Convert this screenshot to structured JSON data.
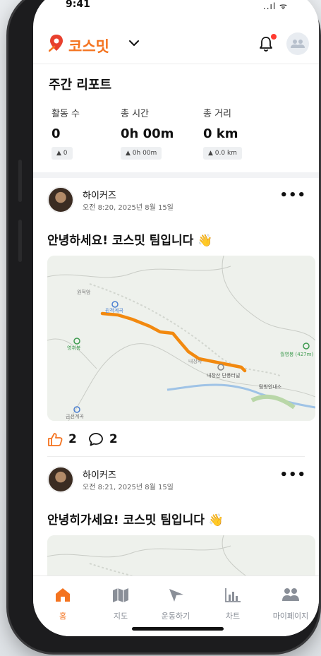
{
  "status_bar": {
    "time": "9:41",
    "signal": "..ıl ᯤ"
  },
  "app": {
    "brand": "코스밋",
    "accent_color": "#f4731f",
    "notification_dot_color": "#ff3b30"
  },
  "weekly_report": {
    "title": "주간 리포트",
    "stats": [
      {
        "label": "활동 수",
        "value": "0",
        "delta": "▲ 0"
      },
      {
        "label": "총 시간",
        "value": "0h 00m",
        "delta": "▲ 0h 00m"
      },
      {
        "label": "총 거리",
        "value": "0 km",
        "delta": "▲ 0.0 km"
      }
    ]
  },
  "posts": [
    {
      "user": "하이커즈",
      "time": "오전 8:20, 2025년 8월 15일",
      "text": "안녕하세요! 코스밋 팀입니다 👋",
      "likes": "2",
      "comments": "2",
      "map_labels": [
        "원적암",
        "원적계곡",
        "영취봉",
        "내장사",
        "내장산 단풍터널",
        "탐방안내소",
        "월영봉 (427m)",
        "금선계곡"
      ]
    },
    {
      "user": "하이커즈",
      "time": "오전 8:21, 2025년 8월 15일",
      "text": "안녕히가세요! 코스밋 팀입니다 👋"
    }
  ],
  "tabs": [
    {
      "label": "홈",
      "icon": "home-icon",
      "active": true
    },
    {
      "label": "지도",
      "icon": "map-icon",
      "active": false
    },
    {
      "label": "운동하기",
      "icon": "navigation-icon",
      "active": false
    },
    {
      "label": "차트",
      "icon": "chart-icon",
      "active": false
    },
    {
      "label": "마이페이지",
      "icon": "people-icon",
      "active": false
    }
  ]
}
